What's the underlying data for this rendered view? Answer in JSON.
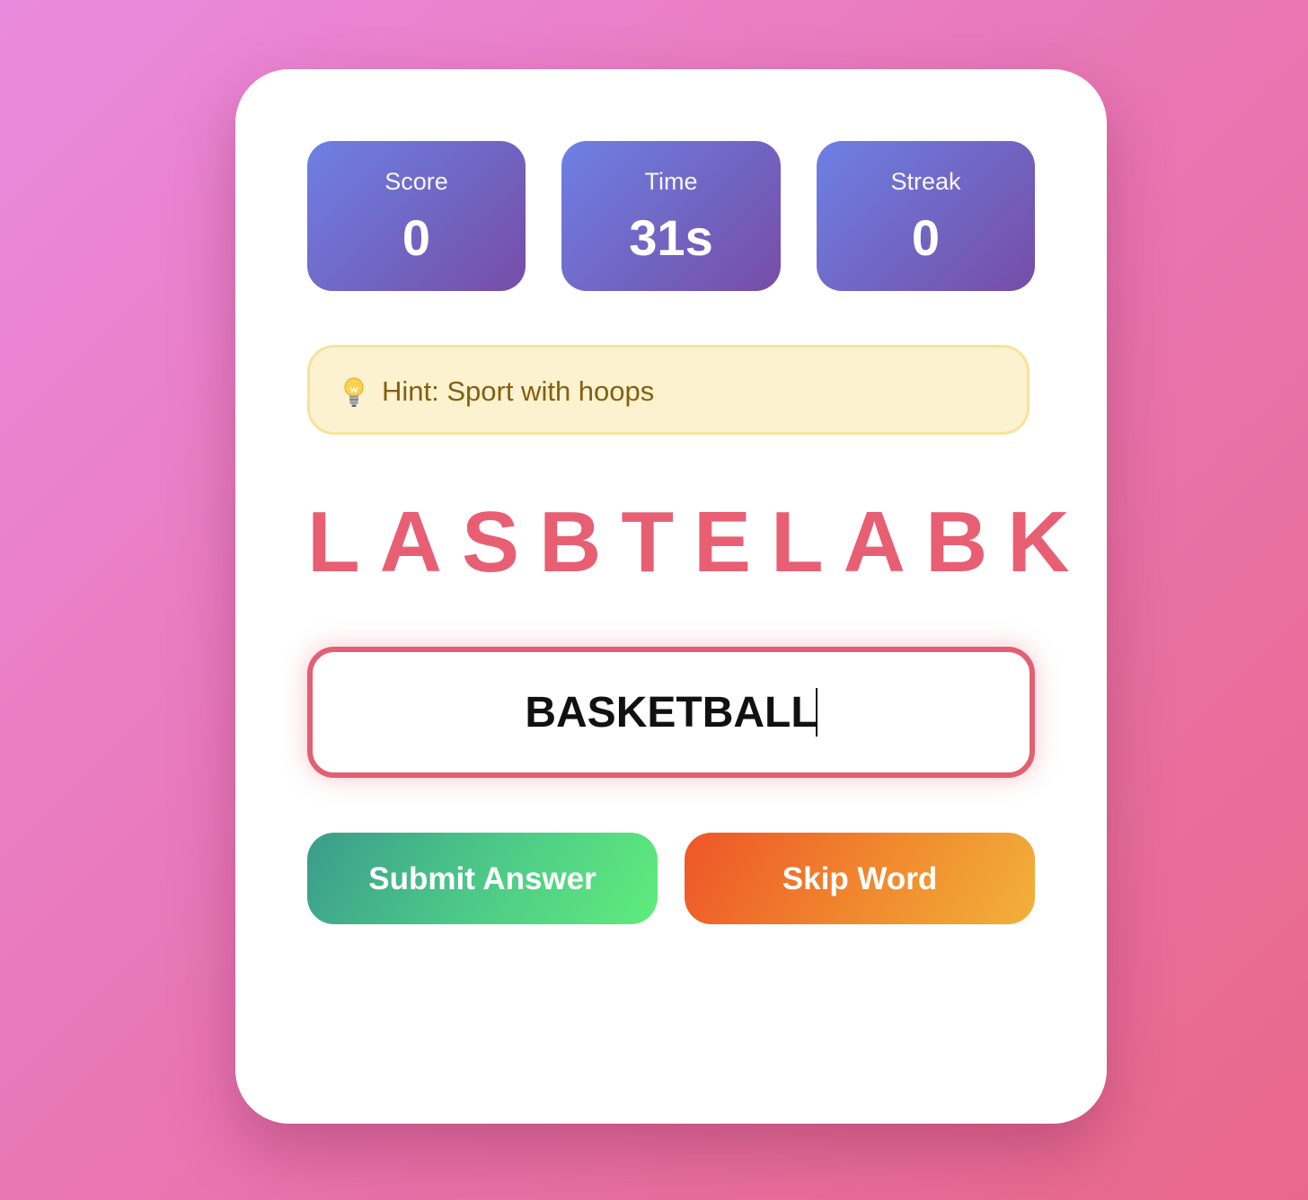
{
  "stats": {
    "score": {
      "label": "Score",
      "value": "0"
    },
    "time": {
      "label": "Time",
      "value": "31s"
    },
    "streak": {
      "label": "Streak",
      "value": "0"
    }
  },
  "hint": {
    "icon": "lightbulb-icon",
    "text": "Hint: Sport with hoops"
  },
  "scrambled_word": "LASBTELABK",
  "answer": {
    "value": "BASKETBALL"
  },
  "buttons": {
    "submit_label": "Submit Answer",
    "skip_label": "Skip Word"
  },
  "colors": {
    "stat_gradient_start": "#6d80e4",
    "stat_gradient_end": "#764da6",
    "scramble_color": "#e85f74",
    "hint_background": "#fdf2cf",
    "hint_text": "#836012",
    "submit_gradient_start": "#3a9c8c",
    "submit_gradient_end": "#5fec7c",
    "skip_gradient_start": "#ee5528",
    "skip_gradient_end": "#f2b13a"
  }
}
